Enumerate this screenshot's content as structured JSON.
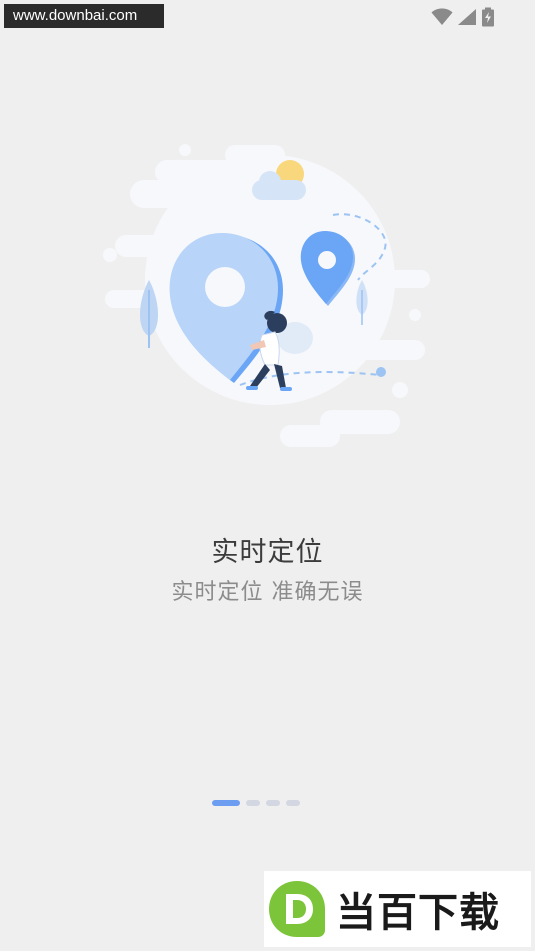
{
  "watermark_top": {
    "text": "www.downbai.com"
  },
  "status_bar": {
    "icons": [
      "wifi-icon",
      "cell-signal-icon",
      "battery-charging-icon"
    ]
  },
  "onboarding": {
    "illustration": "location-pin-illustration",
    "title": "实时定位",
    "subtitle": "实时定位 准确无误",
    "pager": {
      "total": 4,
      "current": 1
    }
  },
  "watermark_bottom": {
    "logo_letter": "D",
    "text": "当百下载"
  },
  "colors": {
    "background": "#efeff0",
    "pin_light": "#b8d4f8",
    "pin_blue": "#6aa6f5",
    "accent_dot": "#6d9df0",
    "logo_green": "#7cc43a"
  }
}
